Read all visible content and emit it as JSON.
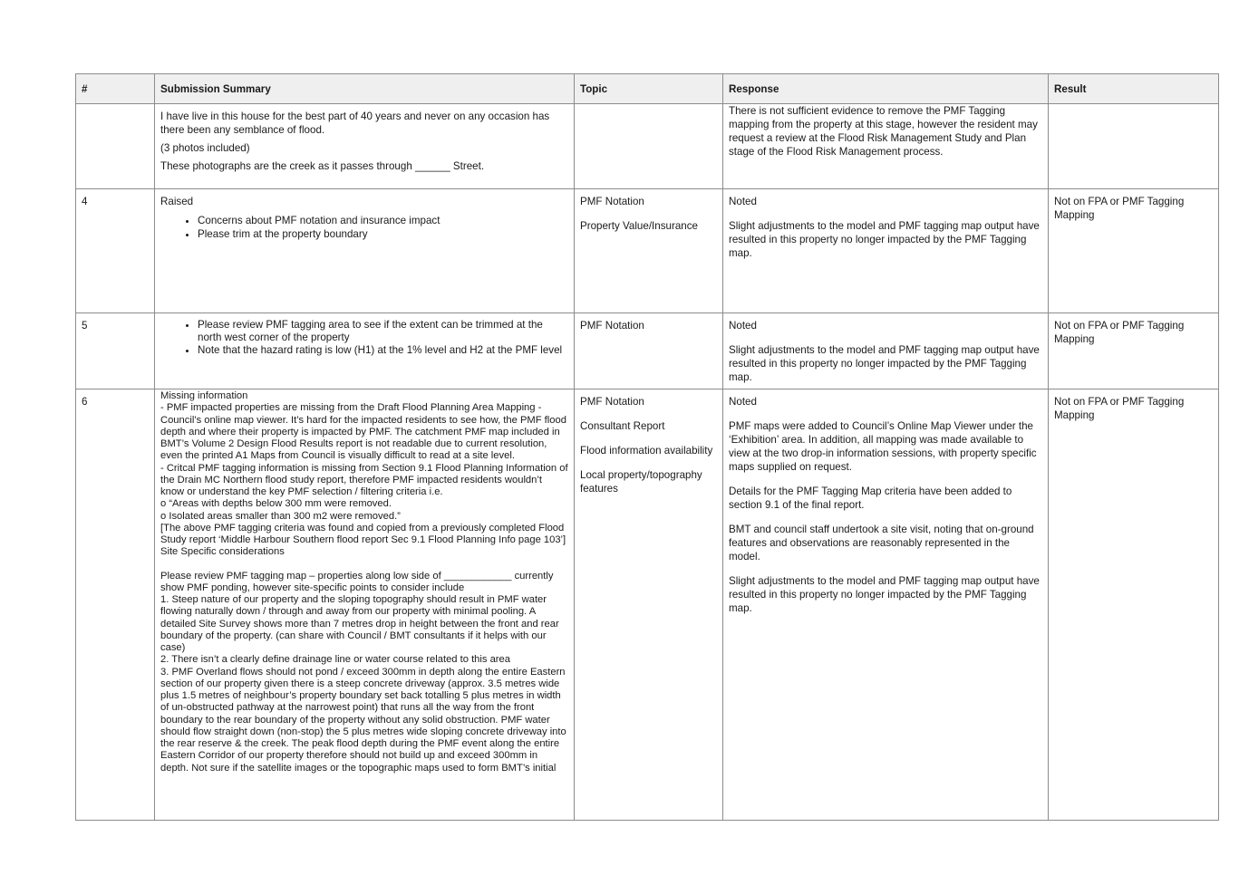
{
  "table": {
    "headers": [
      "#",
      "Submission Summary",
      "Topic",
      "Response",
      "Result"
    ],
    "rows": [
      {
        "num": "",
        "summary": [
          "I have live in this house for the best part of 40 years and never on any occasion has there been any semblance of flood.",
          "(3 photos included)",
          "These photographs are the creek as it passes through ______ Street."
        ],
        "topic": [],
        "response": [
          "There is not sufficient evidence to remove the PMF Tagging mapping from the property at this stage, however the resident may request a review at the Flood Risk Management Study and Plan stage of the Flood Risk Management process."
        ],
        "result": ""
      },
      {
        "num": "4",
        "summary_intro": "Raised",
        "summary_bullets": [
          "Concerns about PMF notation and insurance impact",
          "Please trim at the property boundary"
        ],
        "topic": [
          "PMF Notation",
          "Property Value/Insurance"
        ],
        "response": [
          "Noted",
          "Slight adjustments to the model and PMF tagging map output have resulted in this property no longer impacted by the PMF Tagging map."
        ],
        "result": "Not on FPA or PMF Tagging Mapping"
      },
      {
        "num": "5",
        "summary_bullets": [
          "Please review PMF tagging area to see if the extent can be trimmed at the north west corner of the property",
          "Note that the hazard rating is low (H1) at the 1% level and H2 at the PMF level"
        ],
        "topic": [
          "PMF Notation"
        ],
        "response": [
          "Noted",
          "Slight adjustments to the model and PMF tagging map output have resulted in this property no longer impacted by the PMF Tagging map."
        ],
        "result": "Not on FPA or PMF Tagging Mapping"
      },
      {
        "num": "6",
        "summary_lines": [
          "Missing information",
          "- PMF impacted properties are missing from the Draft Flood Planning Area Mapping - Council’s online map viewer. It’s hard for the impacted residents to see how, the PMF flood depth and where their property is impacted by PMF. The catchment PMF map included in BMT’s Volume 2 Design Flood Results report is not readable due to current resolution, even the printed A1 Maps from Council is visually difficult to read at a site level.",
          "- Critcal PMF tagging information is missing from Section 9.1 Flood Planning Information of the Drain MC Northern flood study report, therefore PMF impacted residents wouldn’t know or understand the key PMF selection / filtering criteria i.e.",
          "o “Areas with depths below 300 mm were removed.",
          "o Isolated areas smaller than 300 m2 were removed.”",
          "[The above PMF tagging criteria was found and copied from a previously completed Flood",
          "Study report ‘Middle Harbour Southern flood report Sec 9.1 Flood Planning Info page 103’]",
          "Site Specific considerations",
          "",
          "Please review PMF tagging map – properties along low side of ____________ currently show PMF ponding, however site-specific points to consider include",
          "1. Steep nature of our property and the sloping topography should result in PMF water flowing naturally down / through and away from our property with minimal pooling. A detailed Site Survey shows more than 7 metres drop in height between the front and rear boundary of the property. (can share with Council / BMT consultants if it helps with our case)",
          "2. There isn’t a clearly define drainage line or water course related to this area",
          "3. PMF Overland flows should not pond / exceed 300mm in depth along the entire Eastern section of our property given there is a steep concrete driveway (approx. 3.5 metres wide plus 1.5 metres of neighbour’s property boundary set back totalling 5 plus metres in width of un-obstructed pathway at the narrowest point) that runs all the way from the front boundary to the rear boundary of the property without any solid obstruction. PMF water should flow straight down (non-stop) the 5 plus metres wide sloping concrete driveway into the rear reserve & the creek. The peak flood depth during the PMF event along the entire Eastern Corridor of our property therefore should not build up and exceed 300mm in depth. Not sure if the satellite images or the topographic maps used to form BMT’s initial"
        ],
        "topic": [
          "PMF Notation",
          "Consultant Report",
          "Flood information availability",
          "Local property/topography features"
        ],
        "response": [
          "Noted",
          "PMF maps were added to Council’s Online Map Viewer under the ‘Exhibition’ area. In addition, all mapping was made available to view at the two drop-in information sessions, with property specific maps supplied on request.",
          "Details for the PMF Tagging Map criteria have been added to section 9.1 of the final report.",
          "BMT and council staff undertook a site visit, noting that on-ground features and observations are reasonably represented in the model.",
          "Slight adjustments to the model and PMF tagging map output have resulted in this property no longer impacted by the PMF Tagging map."
        ],
        "result": "Not on FPA or PMF Tagging Mapping"
      }
    ]
  }
}
